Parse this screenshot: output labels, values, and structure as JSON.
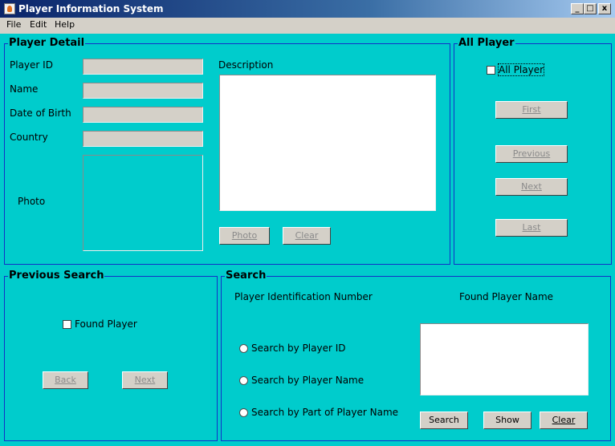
{
  "window": {
    "title": "Player Information System",
    "minimize": "_",
    "maximize": "□",
    "close": "x"
  },
  "menu": [
    "File",
    "Edit",
    "Help"
  ],
  "player_detail": {
    "title": "Player Detail",
    "labels": {
      "player_id": "Player ID",
      "name": "Name",
      "dob": "Date of Birth",
      "country": "Country",
      "photo": "Photo",
      "description": "Description"
    },
    "values": {
      "player_id": "",
      "name": "",
      "dob": "",
      "country": "",
      "description": ""
    },
    "buttons": {
      "photo": "Photo",
      "clear": "Clear"
    }
  },
  "all_player": {
    "title": "All Player",
    "checkbox": "All Player",
    "checked": false,
    "buttons": {
      "first": "First",
      "previous": "Previous",
      "next": "Next",
      "last": "Last"
    }
  },
  "previous_search": {
    "title": "Previous Search",
    "checkbox": "Found Player",
    "checked": false,
    "buttons": {
      "back": "Back",
      "next": "Next"
    }
  },
  "search": {
    "title": "Search",
    "label_id": "Player Identification Number",
    "label_found": "Found Player Name",
    "radios": [
      "Search by Player ID",
      "Search by Player Name",
      "Search by Part of Player Name"
    ],
    "buttons": {
      "search": "Search",
      "show": "Show",
      "clear": "Clear"
    }
  },
  "colors": {
    "panel_bg": "#00cccc",
    "border": "#1230c8",
    "titlebar": "#0a246a"
  }
}
